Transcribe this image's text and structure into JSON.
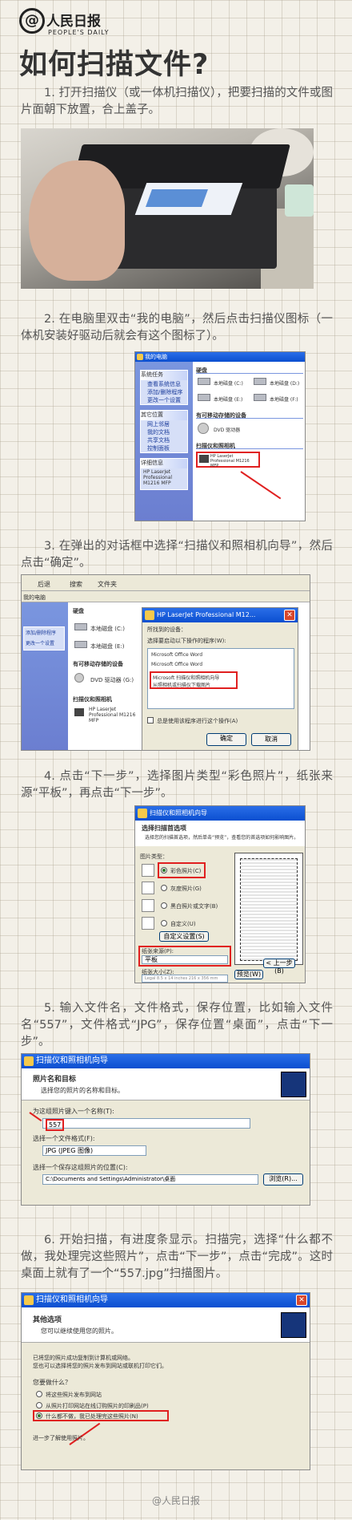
{
  "header": {
    "logo_cn": "人民日报",
    "logo_en": "PEOPLE'S DAILY",
    "title": "如何扫描文件?"
  },
  "steps": [
    "1. 打开扫描仪（或一体机扫描仪），把要扫描的文件或图片面朝下放置，合上盖子。",
    "2. 在电脑里双击“我的电脑”，然后点击扫描仪图标（一体机安装好驱动后就会有这个图标了）。",
    "3. 在弹出的对话框中选择“扫描仪和照相机向导”，然后点击“确定”。",
    "4. 点击“下一步”，选择图片类型“彩色照片”，纸张来源“平板”，再点击“下一步”。",
    "5. 输入文件名，文件格式，保存位置，比如输入文件名“557”，文件格式“JPG”，保存位置“桌面”，点击“下一步”。",
    "6. 开始扫描，有进度条显示。扫描完，选择“什么都不做，我处理完这些照片”，点击“下一步”，点击“完成”。这时桌面上就有了一个“557.jpg”扫描图片。"
  ],
  "shot2": {
    "title": "我的电脑",
    "left_box_titles": [
      "系统任务",
      "其它位置",
      "详细信息"
    ],
    "left_items": [
      "查看系统信息",
      "添加/删除程序",
      "更改一个设置",
      "网上邻居",
      "我的文档",
      "共享文档",
      "控制面板"
    ],
    "section_disk": "硬盘",
    "drives": [
      "本地磁盘 (C:)",
      "本地磁盘 (D:)",
      "本地磁盘 (E:)",
      "本地磁盘 (F:)"
    ],
    "section_removable": "有可移动存储的设备",
    "dvd": "DVD 驱动器",
    "section_scanner": "扫描仪和照相机",
    "scanner": "HP LaserJet Professional M1216 MFP",
    "detail": "HP LaserJet Professional M1216 MFP"
  },
  "shot3": {
    "toolbar": [
      "后退",
      "搜索",
      "文件夹"
    ],
    "addr": "我的电脑",
    "section_disk": "硬盘",
    "drives": [
      "本地磁盘 (C:)",
      "本地磁盘 (E:)"
    ],
    "section_removable": "有可移动存储的设备",
    "dvd": "DVD 驱动器 (G:)",
    "section_scanner": "扫描仪和照相机",
    "scanner": "HP LaserJet Professional M1216 MFP",
    "left_items": [
      "添加/删除程序",
      "更改一个设置"
    ],
    "dialog_title": "HP LaserJet Professional M12...",
    "dialog_line1": "所找到的设备：",
    "dialog_line2": "选择要启动以下操作的程序(W):",
    "apps": [
      "Microsoft Office Word",
      "Microsoft Office Word",
      "Microsoft 扫描仪和照相机向导",
      "从照相机或扫描仪下载图片"
    ],
    "checkbox": "总是使用该程序进行这个操作(A)",
    "ok": "确定",
    "cancel": "取消"
  },
  "shot4": {
    "title": "扫描仪和照相机向导",
    "head": "选择扫描首选项",
    "sub": "选择您的扫描首选项，然后单击“预览”，查看您的首选项如何影响图片。",
    "picture_type": "图片类型：",
    "options": [
      "彩色照片(C)",
      "灰度照片(G)",
      "黑白照片或文字(B)",
      "自定义(U)"
    ],
    "custom_btn": "自定义设置(S)",
    "source_label": "纸张来源(P):",
    "source_value": "平板",
    "paper_label": "纸张大小(Z):",
    "paper_value": "Legal 8.5 x 14 inches 216 x 356 mm",
    "preview_btn": "预览(W)",
    "back_btn": "< 上一步(B)"
  },
  "shot5": {
    "title": "扫描仪和照相机向导",
    "head": "照片名和目标",
    "sub": "选择您的照片的名称和目标。",
    "q1": "为这组照片键入一个名称(T):",
    "name_value": "557",
    "q2": "选择一个文件格式(F):",
    "format_value": "JPG (JPEG 图像)",
    "q3": "选择一个保存这组照片的位置(C):",
    "path_value": "C:\\Documents and Settings\\Administrator\\桌面",
    "browse": "浏览(R)..."
  },
  "shot6": {
    "title": "扫描仪和照相机向导",
    "head": "其他选项",
    "sub": "您可以继续使用您的照片。",
    "info1": "已将您的照片成功复制到计算机或网络。",
    "info2": "您也可以选择将您的照片发布到网站或联机打印它们。",
    "question": "您要做什么？",
    "options": [
      "将这些照片发布到网站",
      "从照片打印网站在线订购照片的印刷品(P)",
      "什么都不做，我已处理完这些照片(N)"
    ],
    "more": "进一步了解使用照片。"
  },
  "footer": "@人民日报"
}
